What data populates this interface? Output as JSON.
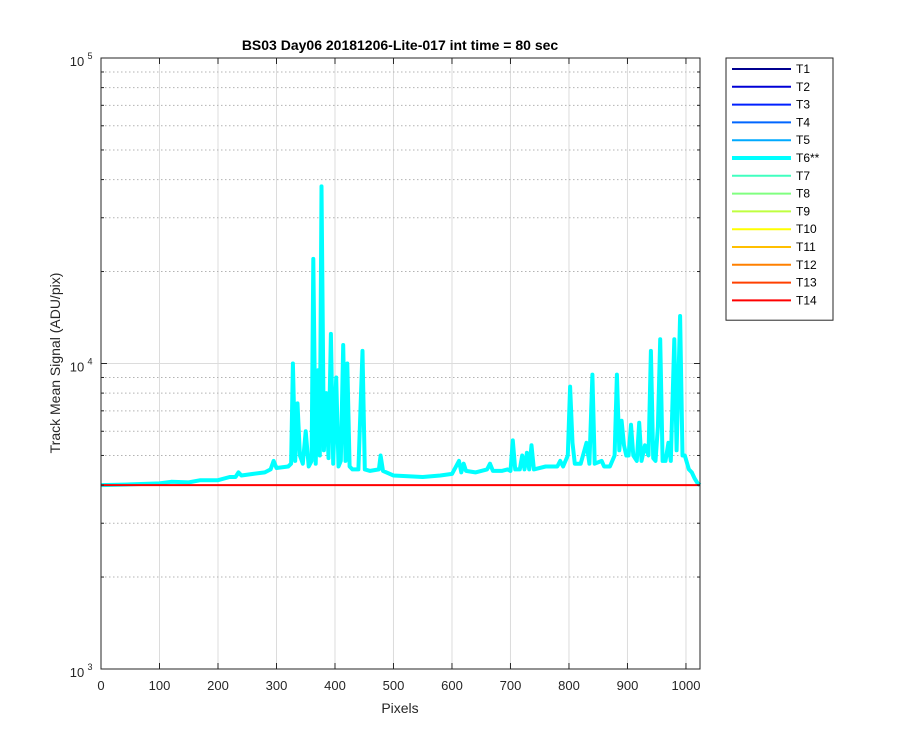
{
  "chart_data": {
    "type": "line",
    "title": "BS03 Day06 20181206-Lite-017 int time = 80 sec",
    "xlabel": "Pixels",
    "ylabel": "Track Mean Signal (ADU/pix)",
    "xlim": [
      0,
      1024
    ],
    "ylim": [
      1000,
      100000
    ],
    "yscale": "log",
    "x_ticks": [
      "0",
      "100",
      "200",
      "300",
      "400",
      "500",
      "600",
      "700",
      "800",
      "900",
      "1000"
    ],
    "x_tick_values": [
      0,
      100,
      200,
      300,
      400,
      500,
      600,
      700,
      800,
      900,
      1000
    ],
    "y_ticks": [
      {
        "value": 1000,
        "base": "10",
        "exp": "3"
      },
      {
        "value": 10000,
        "base": "10",
        "exp": "4"
      },
      {
        "value": 100000,
        "base": "10",
        "exp": "5"
      }
    ],
    "grid": true,
    "legend_position": "outside-right",
    "legend": [
      {
        "label": "T1",
        "color": "#00008f"
      },
      {
        "label": "T2",
        "color": "#0000d6"
      },
      {
        "label": "T3",
        "color": "#0020ff"
      },
      {
        "label": "T4",
        "color": "#0066ff"
      },
      {
        "label": "T5",
        "color": "#00aaff"
      },
      {
        "label": "T6**",
        "color": "#00ffff",
        "highlight": true
      },
      {
        "label": "T7",
        "color": "#40ffbf"
      },
      {
        "label": "T8",
        "color": "#80ff80"
      },
      {
        "label": "T9",
        "color": "#bfff40"
      },
      {
        "label": "T10",
        "color": "#ffff00"
      },
      {
        "label": "T11",
        "color": "#ffbf00"
      },
      {
        "label": "T12",
        "color": "#ff8000"
      },
      {
        "label": "T13",
        "color": "#ff4000"
      },
      {
        "label": "T14",
        "color": "#ff0000"
      }
    ],
    "series": [
      {
        "name": "T6**",
        "color": "#00ffff",
        "points": [
          [
            0,
            4000
          ],
          [
            50,
            4020
          ],
          [
            100,
            4050
          ],
          [
            120,
            4100
          ],
          [
            150,
            4080
          ],
          [
            170,
            4150
          ],
          [
            200,
            4150
          ],
          [
            220,
            4250
          ],
          [
            230,
            4250
          ],
          [
            235,
            4400
          ],
          [
            240,
            4300
          ],
          [
            260,
            4350
          ],
          [
            280,
            4400
          ],
          [
            290,
            4500
          ],
          [
            295,
            4800
          ],
          [
            300,
            4550
          ],
          [
            320,
            4600
          ],
          [
            325,
            4700
          ],
          [
            328,
            10000
          ],
          [
            332,
            4800
          ],
          [
            336,
            7400
          ],
          [
            340,
            5000
          ],
          [
            345,
            4700
          ],
          [
            350,
            6000
          ],
          [
            355,
            4600
          ],
          [
            360,
            4800
          ],
          [
            363,
            22000
          ],
          [
            367,
            4700
          ],
          [
            371,
            9500
          ],
          [
            374,
            5000
          ],
          [
            377,
            38000
          ],
          [
            381,
            5200
          ],
          [
            385,
            8000
          ],
          [
            389,
            4900
          ],
          [
            393,
            12500
          ],
          [
            397,
            4700
          ],
          [
            402,
            9000
          ],
          [
            406,
            4600
          ],
          [
            410,
            4800
          ],
          [
            414,
            11500
          ],
          [
            418,
            4800
          ],
          [
            421,
            10000
          ],
          [
            425,
            4600
          ],
          [
            430,
            4500
          ],
          [
            440,
            4500
          ],
          [
            447,
            11000
          ],
          [
            451,
            4500
          ],
          [
            460,
            4450
          ],
          [
            475,
            4500
          ],
          [
            478,
            5000
          ],
          [
            482,
            4450
          ],
          [
            500,
            4300
          ],
          [
            550,
            4250
          ],
          [
            580,
            4300
          ],
          [
            600,
            4350
          ],
          [
            612,
            4800
          ],
          [
            616,
            4400
          ],
          [
            620,
            4700
          ],
          [
            624,
            4450
          ],
          [
            640,
            4400
          ],
          [
            660,
            4500
          ],
          [
            665,
            4700
          ],
          [
            670,
            4450
          ],
          [
            685,
            4450
          ],
          [
            695,
            4500
          ],
          [
            700,
            4450
          ],
          [
            704,
            5600
          ],
          [
            708,
            4500
          ],
          [
            716,
            4500
          ],
          [
            720,
            5000
          ],
          [
            724,
            4500
          ],
          [
            728,
            5100
          ],
          [
            732,
            4500
          ],
          [
            736,
            5400
          ],
          [
            740,
            4500
          ],
          [
            760,
            4600
          ],
          [
            780,
            4600
          ],
          [
            785,
            4800
          ],
          [
            790,
            4600
          ],
          [
            798,
            5000
          ],
          [
            802,
            8400
          ],
          [
            806,
            5500
          ],
          [
            810,
            4700
          ],
          [
            820,
            4700
          ],
          [
            830,
            5500
          ],
          [
            835,
            4700
          ],
          [
            840,
            9200
          ],
          [
            844,
            4700
          ],
          [
            856,
            4800
          ],
          [
            860,
            4600
          ],
          [
            870,
            4600
          ],
          [
            878,
            5000
          ],
          [
            882,
            9200
          ],
          [
            886,
            5200
          ],
          [
            890,
            6500
          ],
          [
            894,
            5400
          ],
          [
            898,
            5000
          ],
          [
            902,
            5000
          ],
          [
            906,
            6300
          ],
          [
            910,
            5000
          ],
          [
            916,
            4800
          ],
          [
            920,
            6400
          ],
          [
            924,
            4800
          ],
          [
            930,
            5400
          ],
          [
            936,
            5000
          ],
          [
            940,
            11000
          ],
          [
            944,
            4900
          ],
          [
            948,
            4800
          ],
          [
            952,
            6200
          ],
          [
            956,
            12000
          ],
          [
            960,
            4800
          ],
          [
            965,
            4800
          ],
          [
            970,
            5500
          ],
          [
            974,
            4800
          ],
          [
            980,
            12000
          ],
          [
            984,
            5200
          ],
          [
            990,
            14300
          ],
          [
            994,
            5000
          ],
          [
            998,
            5000
          ],
          [
            1005,
            4500
          ],
          [
            1010,
            4400
          ],
          [
            1015,
            4200
          ],
          [
            1020,
            4050
          ],
          [
            1024,
            4000
          ]
        ]
      },
      {
        "name": "T14",
        "color": "#ff0000",
        "points": [
          [
            0,
            4000
          ],
          [
            1024,
            4000
          ]
        ]
      }
    ]
  }
}
